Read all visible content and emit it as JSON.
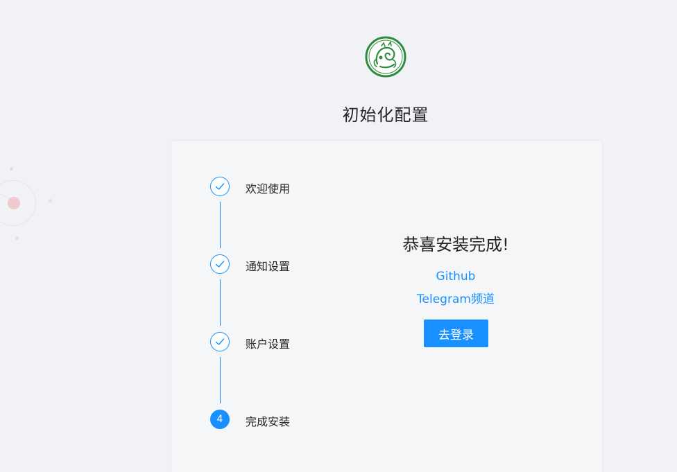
{
  "header": {
    "logo_icon": "dragon-seal-logo-icon",
    "title": "初始化配置"
  },
  "steps": [
    {
      "label": "欢迎使用",
      "status": "finished",
      "icon": "check-icon"
    },
    {
      "label": "通知设置",
      "status": "finished",
      "icon": "check-icon"
    },
    {
      "label": "账户设置",
      "status": "finished",
      "icon": "check-icon"
    },
    {
      "label": "完成安装",
      "status": "active",
      "number": "4"
    }
  ],
  "result": {
    "title": "恭喜安装完成!",
    "links": [
      {
        "label": "Github"
      },
      {
        "label": "Telegram频道"
      }
    ],
    "login_button": "去登录"
  },
  "colors": {
    "primary": "#1890ff",
    "background": "#f0f2f5",
    "card": "#f5f6f8",
    "logo_green": "#2e8b3e"
  }
}
